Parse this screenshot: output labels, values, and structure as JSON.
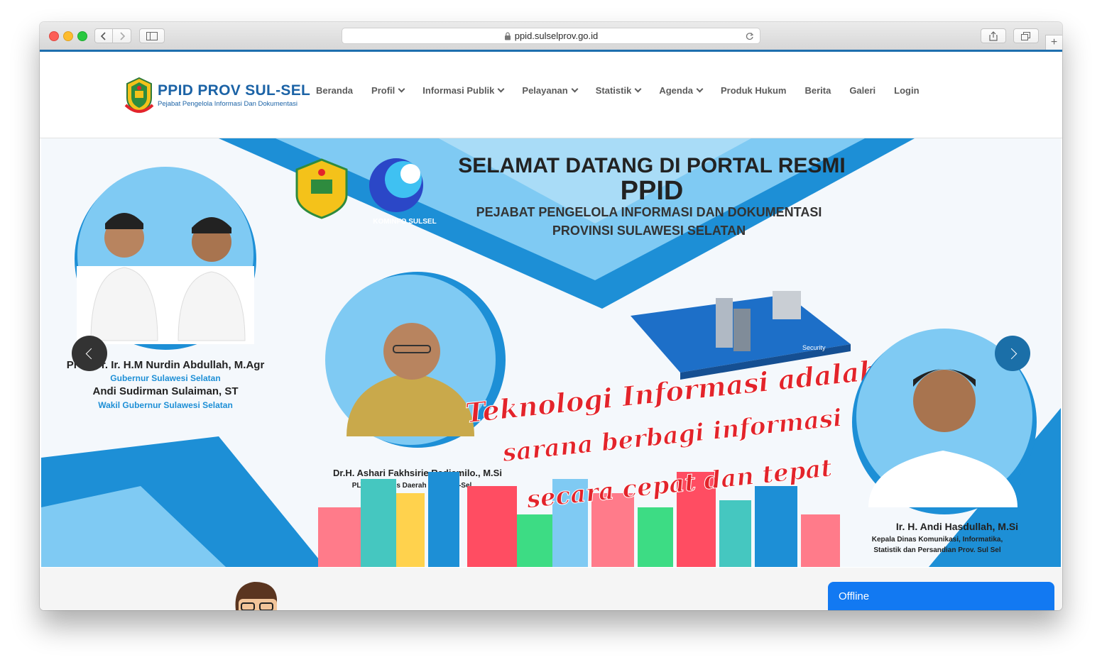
{
  "browser": {
    "url": "ppid.sulselprov.go.id",
    "new_tab_glyph": "+"
  },
  "site": {
    "logo_title": "PPID PROV SUL-SEL",
    "logo_subtitle": "Pejabat Pengelola Informasi Dan Dokumentasi",
    "nav": [
      {
        "label": "Beranda",
        "dropdown": false
      },
      {
        "label": "Profil",
        "dropdown": true
      },
      {
        "label": "Informasi Publik",
        "dropdown": true
      },
      {
        "label": "Pelayanan",
        "dropdown": true
      },
      {
        "label": "Statistik",
        "dropdown": true
      },
      {
        "label": "Agenda",
        "dropdown": true
      },
      {
        "label": "Produk Hukum",
        "dropdown": false
      },
      {
        "label": "Berita",
        "dropdown": false
      },
      {
        "label": "Galeri",
        "dropdown": false
      },
      {
        "label": "Login",
        "dropdown": false
      }
    ]
  },
  "banner": {
    "heading": "SELAMAT DATANG DI PORTAL RESMI",
    "heading_big": "PPID",
    "subheading_1": "PEJABAT PENGELOLA INFORMASI DAN DOKUMENTASI",
    "subheading_2": "PROVINSI SULAWESI SELATAN",
    "kominfo_label": "KOMINFO SULSEL",
    "governor_name": "Prof. Dr. Ir. H.M Nurdin Abdullah, M.Agr",
    "governor_title": "Gubernur Sulawesi Selatan",
    "vice_name": "Andi Sudirman Sulaiman, ST",
    "vice_title": "Wakil Gubernur Sulawesi Selatan",
    "secretary_name": "Dr.H. Ashari Fakhsirie Radjamilo., M.Si",
    "secretary_title": "PLT.Sekretaris Daerah Prov. Sul-Sel",
    "slogan_1": "Teknologi Informasi adalah",
    "slogan_2": "sarana berbagi informasi",
    "slogan_3": "secara cepat dan tepat",
    "kadis_name": "Ir. H. Andi Hasdullah, M.Si",
    "kadis_title_1": "Kepala Dinas Komunikasi, Informatika,",
    "kadis_title_2": "Statistik dan Persandian Prov. Sul Sel",
    "security_label": "Security"
  },
  "chat": {
    "status": "Offline"
  },
  "colors": {
    "brand_blue": "#1c63a6",
    "banner_blue": "#1d8fd6",
    "light_blue": "#7fcaf3",
    "slogan_red": "#e3242b",
    "chat_blue": "#1279f2",
    "carousel_prev": "#333333",
    "carousel_next": "#1b6fa8"
  },
  "icons": [
    "lock-icon",
    "reload-icon",
    "share-icon",
    "tabs-icon",
    "sidebar-icon",
    "chevron-left-icon",
    "chevron-right-icon",
    "chevron-down-icon"
  ]
}
